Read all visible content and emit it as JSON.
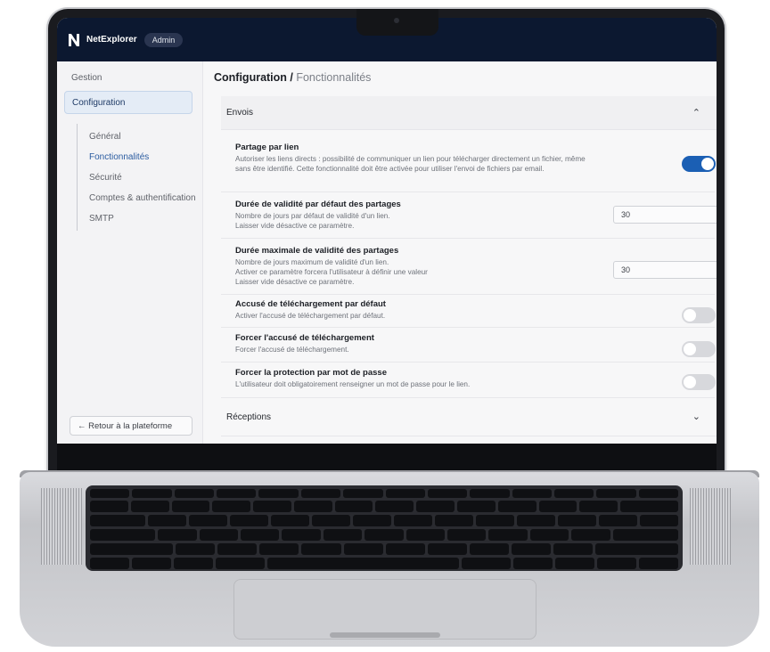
{
  "app": {
    "brand": "NetExplorer",
    "role_badge": "Admin"
  },
  "sidebar": {
    "gestion": "Gestion",
    "configuration": "Configuration",
    "subitems": [
      "Général",
      "Fonctionnalités",
      "Sécurité",
      "Comptes & authentification",
      "SMTP"
    ],
    "active_subitem": "Fonctionnalités",
    "back_button": "← Retour à la plateforme"
  },
  "page": {
    "title_main": "Configuration /",
    "title_sub": " Fonctionnalités"
  },
  "envois": {
    "title": "Envois",
    "expanded": true,
    "settings": [
      {
        "name": "Partage par lien",
        "desc": "Autoriser les liens directs : possibilité de communiquer un lien pour télécharger directement un fichier, même sans être identifié. Cette fonctionnalité doit être activée pour utiliser l'envoi de fichiers par email.",
        "type": "toggle",
        "enabled": true
      },
      {
        "name": "Durée de validité par défaut des partages",
        "desc": "Nombre de jours par défaut de validité d'un lien.\nLaisser vide désactive ce paramètre.",
        "type": "input",
        "value": "30"
      },
      {
        "name": "Durée maximale de validité des partages",
        "desc": "Nombre de jours maximum de validité d'un lien.\nActiver ce paramètre forcera l'utilisateur à définir une valeur\nLaisser vide désactive ce paramètre.",
        "type": "input",
        "value": "30"
      },
      {
        "name": "Accusé de téléchargement par défaut",
        "desc": "Activer l'accusé de téléchargement par défaut.",
        "type": "toggle",
        "enabled": false
      },
      {
        "name": "Forcer l'accusé de téléchargement",
        "desc": "Forcer l'accusé de téléchargement.",
        "type": "toggle",
        "enabled": false
      },
      {
        "name": "Forcer la protection par mot de passe",
        "desc": "L'utilisateur doit obligatoirement renseigner un mot de passe pour le lien.",
        "type": "toggle",
        "enabled": false
      }
    ]
  },
  "receptions": {
    "title": "Réceptions",
    "expanded": false
  },
  "icons": {
    "collapse": "chevron-up-icon",
    "expand": "chevron-down-icon",
    "logo": "netexplorer-logo-icon"
  },
  "colors": {
    "topbar": "#0c1830",
    "accent": "#1b5fb4",
    "nav_active_bg": "#e4ecf6"
  }
}
